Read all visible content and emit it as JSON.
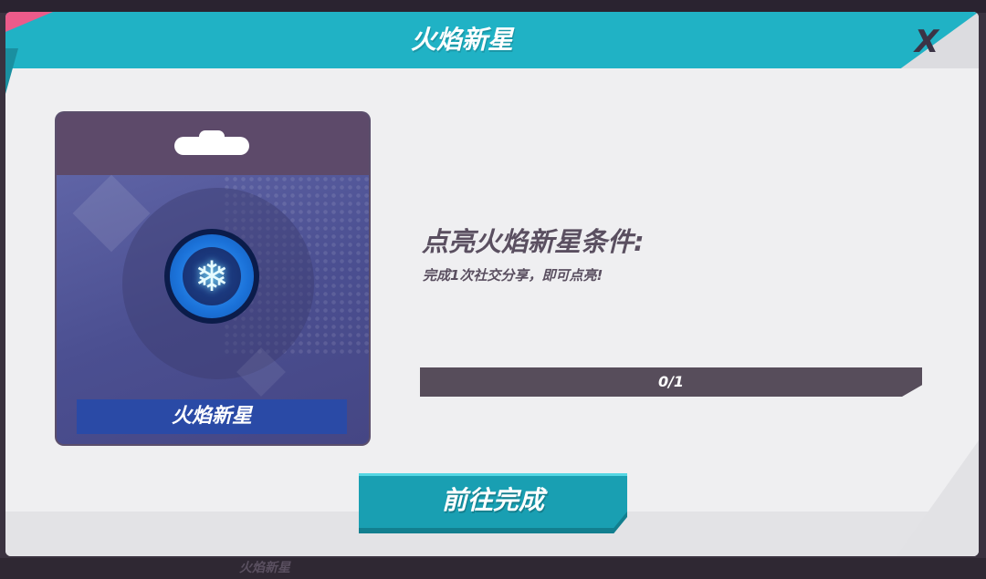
{
  "background": {
    "bottom_text": "火焰新星"
  },
  "modal": {
    "title": "火焰新星",
    "close_label": "X"
  },
  "badge_card": {
    "label": "火焰新星",
    "icon": "snowflake-medal-icon"
  },
  "condition": {
    "title": "点亮火焰新星条件:",
    "description": "完成1次社交分享，即可点亮!"
  },
  "progress": {
    "text": "0/1",
    "current": 0,
    "total": 1
  },
  "actions": {
    "go_label": "前往完成"
  },
  "colors": {
    "header_teal": "#20b2c5",
    "button_teal": "#199fb2",
    "accent_pink": "#ec5b8a",
    "card_purple": "#5d4a6a",
    "progress_track": "#574d5b"
  }
}
